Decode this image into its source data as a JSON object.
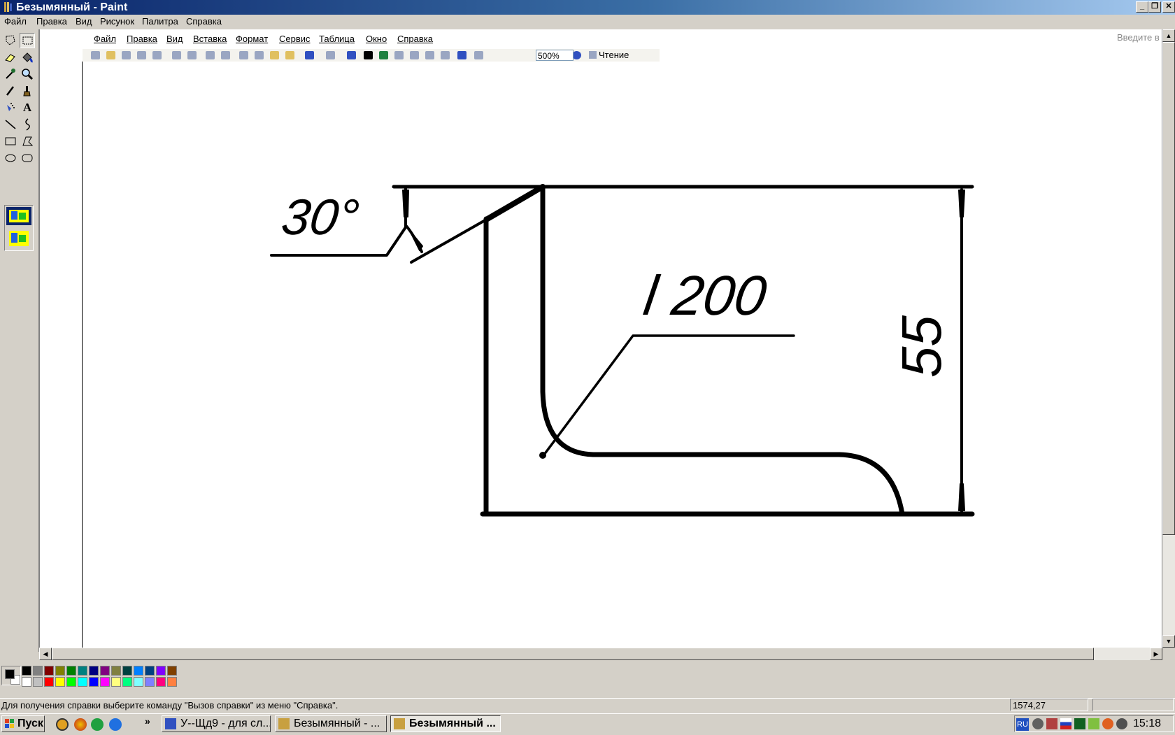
{
  "window": {
    "title": "Безымянный - Paint"
  },
  "menubar": {
    "items": [
      "Файл",
      "Правка",
      "Вид",
      "Рисунок",
      "Палитра",
      "Справка"
    ]
  },
  "word_menu": {
    "items": [
      "Файл",
      "Правка",
      "Вид",
      "Вставка",
      "Формат",
      "Сервис",
      "Таблица",
      "Окно",
      "Справка"
    ]
  },
  "word_toolbar": {
    "zoom": "500%",
    "reading": "Чтение"
  },
  "help_box": {
    "placeholder": "Введите в"
  },
  "drawing": {
    "angle_label": "30°",
    "weld_label": "l 200",
    "dimension_label": "55"
  },
  "palette": {
    "row1": [
      "#000000",
      "#808080",
      "#800000",
      "#808000",
      "#008000",
      "#008080",
      "#000080",
      "#800080",
      "#808040",
      "#004040",
      "#0080ff",
      "#004080",
      "#8000ff",
      "#804000"
    ],
    "row2": [
      "#ffffff",
      "#c0c0c0",
      "#ff0000",
      "#ffff00",
      "#00ff00",
      "#00ffff",
      "#0000ff",
      "#ff00ff",
      "#ffff80",
      "#00ff80",
      "#80ffff",
      "#8080ff",
      "#ff0080",
      "#ff8040"
    ],
    "fg": "#000000",
    "bg": "#ffffff"
  },
  "status": {
    "help_text": "Для получения справки выберите команду \"Вызов справки\" из меню \"Справка\".",
    "coords": "1574,27"
  },
  "taskbar": {
    "start": "Пуск",
    "tasks": [
      "У--Щд9 - для сл...",
      "Безымянный - ...",
      "Безымянный ..."
    ],
    "chevron": "»",
    "lang": "RU",
    "clock": "15:18"
  }
}
